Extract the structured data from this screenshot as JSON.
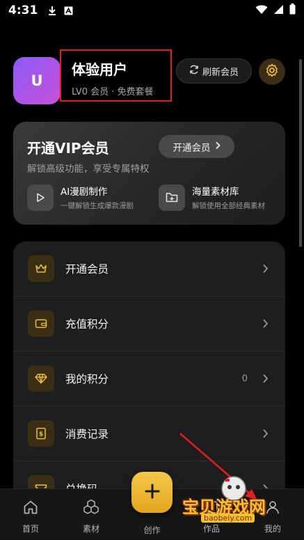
{
  "status_bar": {
    "time": "4:31"
  },
  "profile": {
    "avatar_letter": "U",
    "name": "体验用户",
    "subtitle": "LV0 会员 · 免费套餐",
    "refresh_label": "刷新会员"
  },
  "vip": {
    "title": "开通VIP会员",
    "description": "解锁高级功能，享受专属特权",
    "button_label": "开通会员",
    "features": [
      {
        "title": "AI漫剧制作",
        "desc": "一键解锁生成爆款漫剧",
        "icon": "play-icon"
      },
      {
        "title": "海量素材库",
        "desc": "解锁使用全部经典素材",
        "icon": "folder-plus-icon"
      }
    ]
  },
  "menu": [
    {
      "label": "开通会员",
      "icon": "crown-icon"
    },
    {
      "label": "充值积分",
      "icon": "wallet-icon"
    },
    {
      "label": "我的积分",
      "icon": "diamond-icon",
      "value": "0"
    },
    {
      "label": "消费记录",
      "icon": "receipt-icon"
    },
    {
      "label": "兑换码",
      "icon": "ticket-icon"
    }
  ],
  "bottom_nav": {
    "home": "首页",
    "materials": "素材",
    "create": "创作",
    "works": "作品",
    "mine": "我的"
  },
  "watermark": {
    "text": "宝贝游戏网",
    "url": "baobeiy.com"
  },
  "colors": {
    "accent": "#f0bd3a",
    "background": "#000000",
    "card": "#1e1e1e"
  }
}
